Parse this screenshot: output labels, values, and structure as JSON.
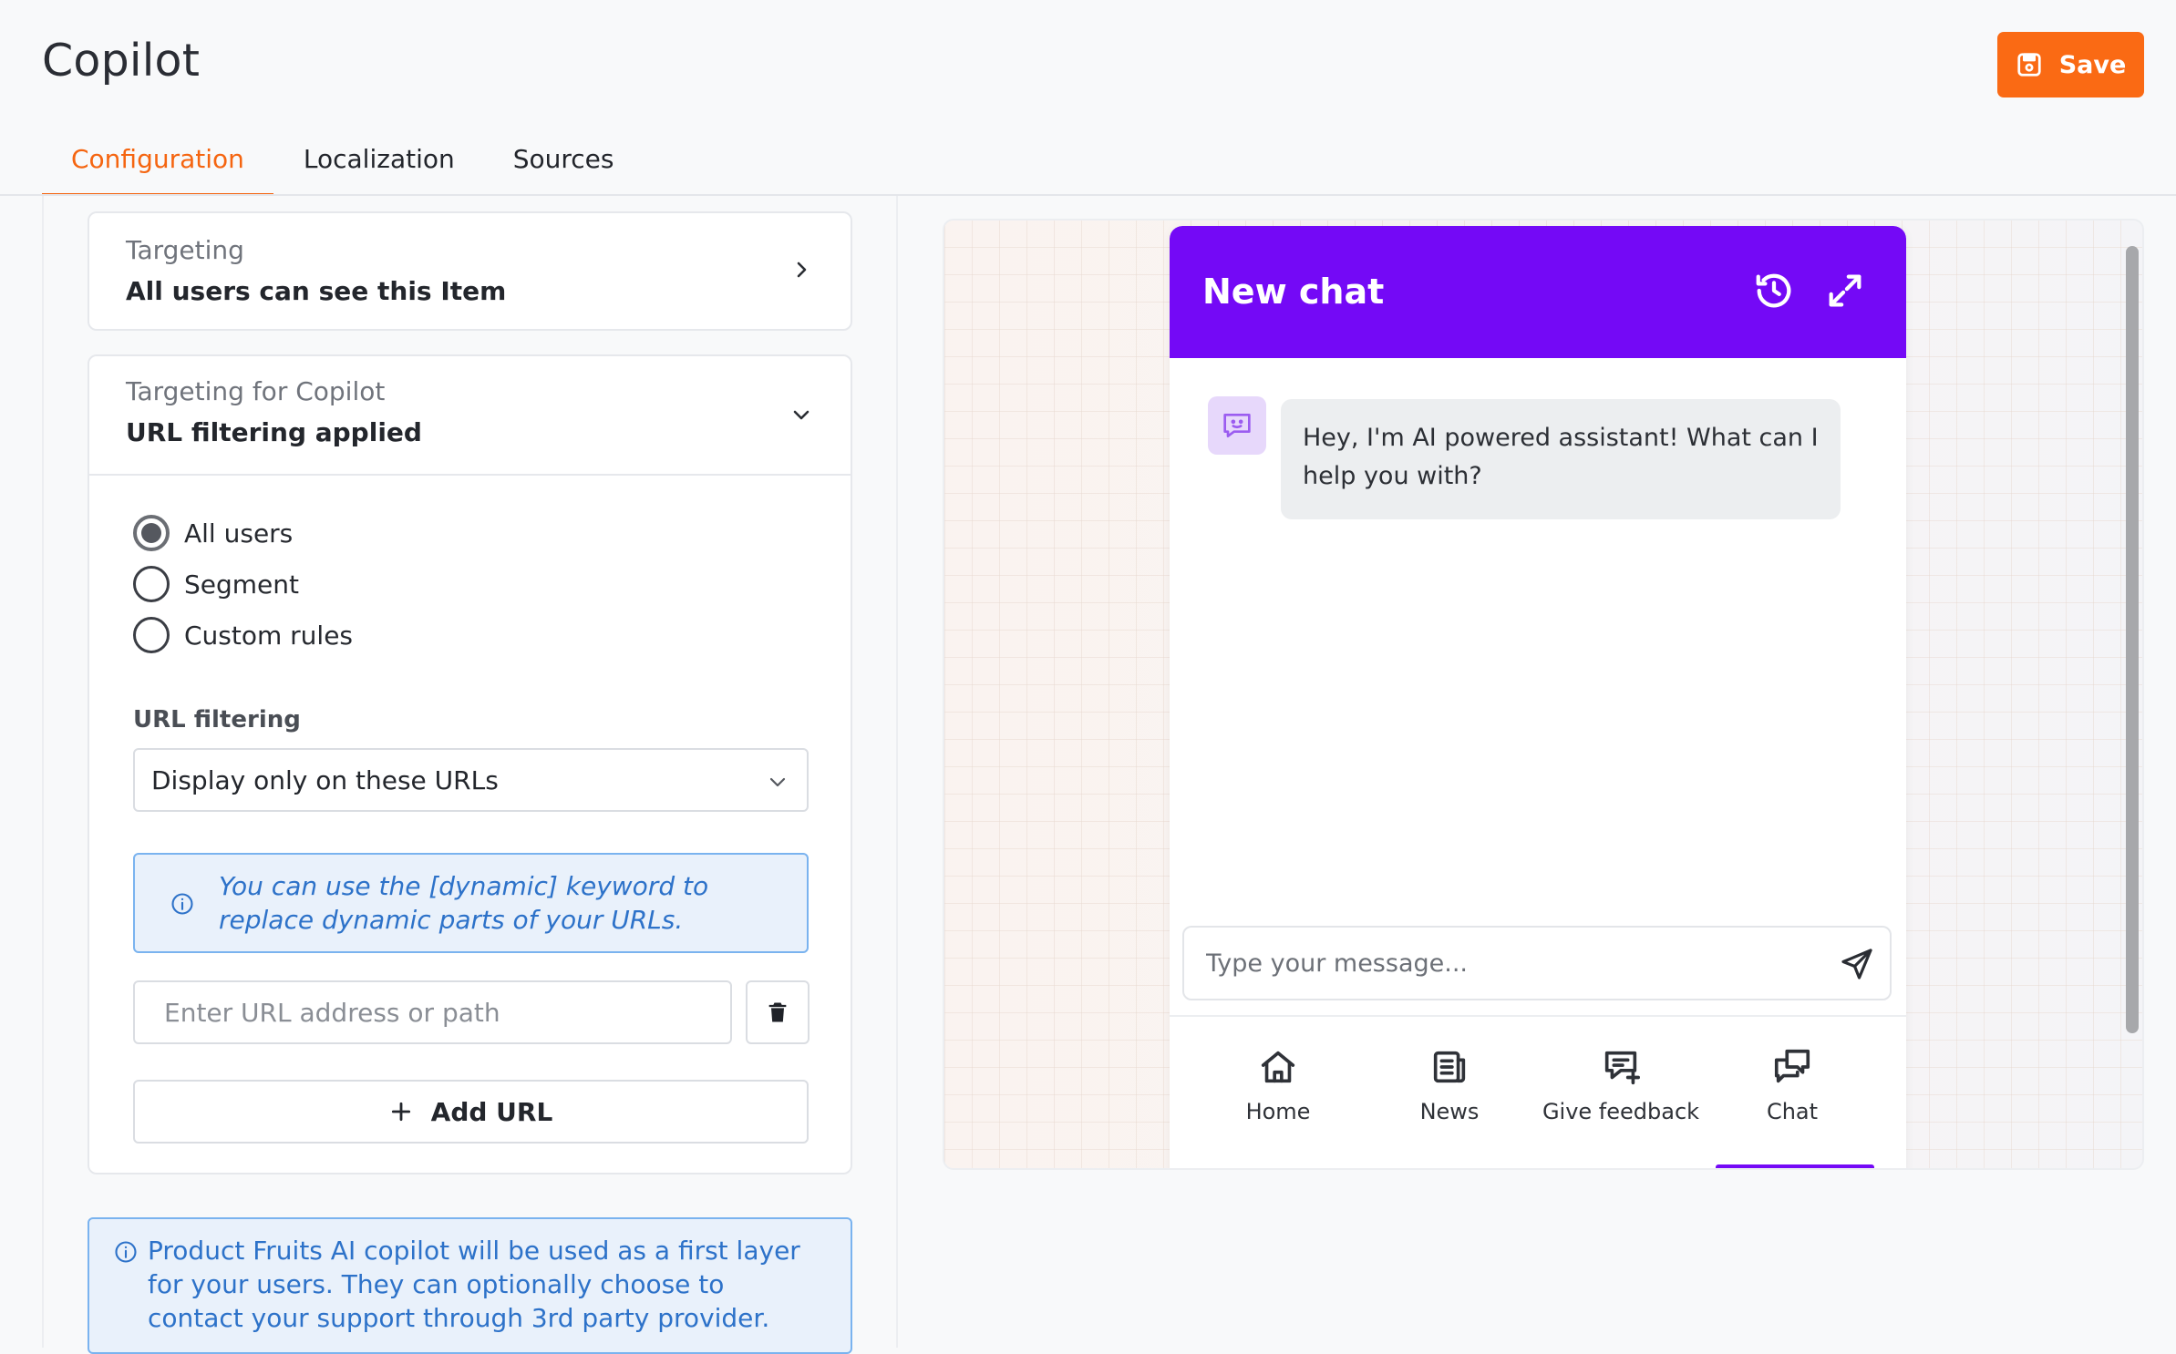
{
  "header": {
    "title": "Copilot",
    "save_label": "Save"
  },
  "tabs": [
    {
      "label": "Configuration",
      "active": true
    },
    {
      "label": "Localization",
      "active": false
    },
    {
      "label": "Sources",
      "active": false
    }
  ],
  "targeting": {
    "label": "Targeting",
    "value": "All users can see this Item"
  },
  "copilot_targeting": {
    "label": "Targeting for Copilot",
    "value": "URL filtering applied",
    "audience_options": [
      {
        "label": "All users",
        "selected": true
      },
      {
        "label": "Segment",
        "selected": false
      },
      {
        "label": "Custom rules",
        "selected": false
      }
    ],
    "url_filtering_label": "URL filtering",
    "url_filtering_value": "Display only on these URLs",
    "dynamic_hint": "You can use the [dynamic] keyword to replace dynamic parts of your URLs.",
    "url_placeholder": "Enter URL address or path",
    "url_value": "",
    "add_url_label": "Add URL"
  },
  "info_note": "Product Fruits AI copilot will be used as a first layer for your users. They can optionally choose to contact your support through 3rd party provider.",
  "preview": {
    "chat_title": "New chat",
    "bot_message": "Hey, I'm AI powered assistant! What can I help you with?",
    "message_placeholder": "Type your message...",
    "nav": [
      {
        "label": "Home",
        "icon": "home-icon"
      },
      {
        "label": "News",
        "icon": "news-icon"
      },
      {
        "label": "Give feedback",
        "icon": "feedback-icon"
      },
      {
        "label": "Chat",
        "icon": "chat-icon",
        "active": true
      }
    ]
  },
  "colors": {
    "accent": "#f56510",
    "save_button": "#fa6a14",
    "widget_brand": "#7409f6",
    "info_text": "#2d72c9",
    "info_bg": "#e9f1fb"
  }
}
